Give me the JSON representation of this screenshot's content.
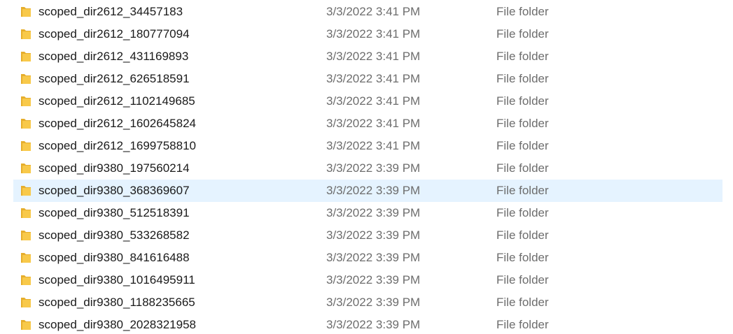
{
  "colors": {
    "folder_body": "#f8c94a",
    "folder_tab": "#e6ae2c",
    "hover_background": "#e5f3ff",
    "secondary_text": "#6d6d6d"
  },
  "files": [
    {
      "name": "scoped_dir2612_34457183",
      "date": "3/3/2022 3:41 PM",
      "type": "File folder",
      "icon": "folder-icon"
    },
    {
      "name": "scoped_dir2612_180777094",
      "date": "3/3/2022 3:41 PM",
      "type": "File folder",
      "icon": "folder-icon"
    },
    {
      "name": "scoped_dir2612_431169893",
      "date": "3/3/2022 3:41 PM",
      "type": "File folder",
      "icon": "folder-icon"
    },
    {
      "name": "scoped_dir2612_626518591",
      "date": "3/3/2022 3:41 PM",
      "type": "File folder",
      "icon": "folder-icon"
    },
    {
      "name": "scoped_dir2612_1102149685",
      "date": "3/3/2022 3:41 PM",
      "type": "File folder",
      "icon": "folder-icon"
    },
    {
      "name": "scoped_dir2612_1602645824",
      "date": "3/3/2022 3:41 PM",
      "type": "File folder",
      "icon": "folder-icon"
    },
    {
      "name": "scoped_dir2612_1699758810",
      "date": "3/3/2022 3:41 PM",
      "type": "File folder",
      "icon": "folder-icon"
    },
    {
      "name": "scoped_dir9380_197560214",
      "date": "3/3/2022 3:39 PM",
      "type": "File folder",
      "icon": "folder-icon"
    },
    {
      "name": "scoped_dir9380_368369607",
      "date": "3/3/2022 3:39 PM",
      "type": "File folder",
      "icon": "folder-icon",
      "hovered": true
    },
    {
      "name": "scoped_dir9380_512518391",
      "date": "3/3/2022 3:39 PM",
      "type": "File folder",
      "icon": "folder-icon"
    },
    {
      "name": "scoped_dir9380_533268582",
      "date": "3/3/2022 3:39 PM",
      "type": "File folder",
      "icon": "folder-icon"
    },
    {
      "name": "scoped_dir9380_841616488",
      "date": "3/3/2022 3:39 PM",
      "type": "File folder",
      "icon": "folder-icon"
    },
    {
      "name": "scoped_dir9380_1016495911",
      "date": "3/3/2022 3:39 PM",
      "type": "File folder",
      "icon": "folder-icon"
    },
    {
      "name": "scoped_dir9380_1188235665",
      "date": "3/3/2022 3:39 PM",
      "type": "File folder",
      "icon": "folder-icon"
    },
    {
      "name": "scoped_dir9380_2028321958",
      "date": "3/3/2022 3:39 PM",
      "type": "File folder",
      "icon": "folder-icon"
    }
  ]
}
